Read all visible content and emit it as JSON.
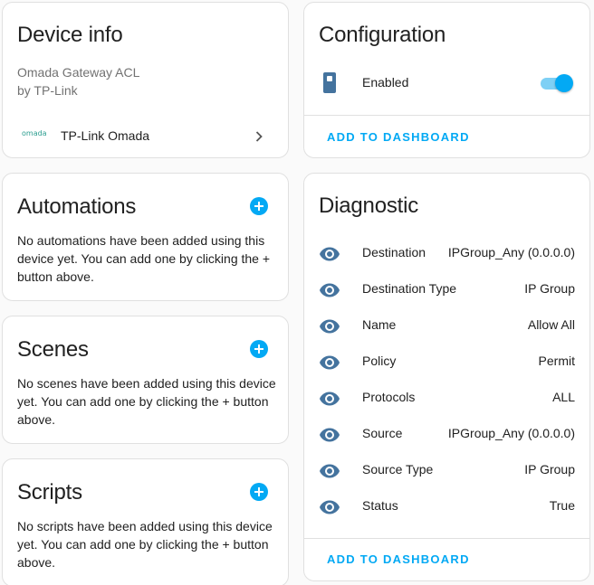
{
  "device_info": {
    "title": "Device info",
    "model": "Omada Gateway ACL",
    "manufacturer": "by TP-Link",
    "integration_logo_text": "omada",
    "integration_name": "TP-Link Omada"
  },
  "automations": {
    "title": "Automations",
    "empty_text": "No automations have been added using this device yet. You can add one by clicking the + button above."
  },
  "scenes": {
    "title": "Scenes",
    "empty_text": "No scenes have been added using this device yet. You can add one by clicking the + button above."
  },
  "scripts": {
    "title": "Scripts",
    "empty_text": "No scripts have been added using this device yet. You can add one by clicking the + button above."
  },
  "configuration": {
    "title": "Configuration",
    "entities": [
      {
        "icon": "phone-device-icon",
        "label": "Enabled",
        "toggle_on": true
      }
    ],
    "action_label": "ADD TO DASHBOARD"
  },
  "diagnostic": {
    "title": "Diagnostic",
    "entities": [
      {
        "icon": "eye-icon",
        "label": "Destination",
        "value": "IPGroup_Any (0.0.0.0)"
      },
      {
        "icon": "eye-icon",
        "label": "Destination Type",
        "value": "IP Group"
      },
      {
        "icon": "eye-icon",
        "label": "Name",
        "value": "Allow All"
      },
      {
        "icon": "eye-icon",
        "label": "Policy",
        "value": "Permit"
      },
      {
        "icon": "eye-icon",
        "label": "Protocols",
        "value": "ALL"
      },
      {
        "icon": "eye-icon",
        "label": "Source",
        "value": "IPGroup_Any (0.0.0.0)"
      },
      {
        "icon": "eye-icon",
        "label": "Source Type",
        "value": "IP Group"
      },
      {
        "icon": "eye-icon",
        "label": "Status",
        "value": "True"
      }
    ],
    "action_label": "ADD TO DASHBOARD"
  },
  "colors": {
    "accent": "#03a9f4",
    "icon": "#44739e",
    "text": "#212121",
    "muted": "#727272"
  }
}
